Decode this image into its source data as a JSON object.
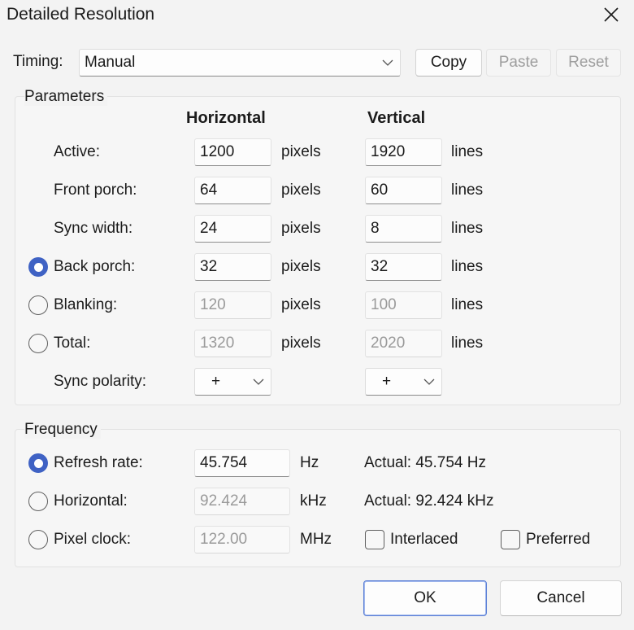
{
  "window": {
    "title": "Detailed Resolution"
  },
  "timing": {
    "label": "Timing:",
    "value": "Manual"
  },
  "actions": {
    "copy": "Copy",
    "paste": "Paste",
    "reset": "Reset"
  },
  "parameters": {
    "group_label": "Parameters",
    "col_horizontal": "Horizontal",
    "col_vertical": "Vertical",
    "h_unit": "pixels",
    "v_unit": "lines",
    "rows": [
      {
        "label": "Active:",
        "h": "1200",
        "v": "1920"
      },
      {
        "label": "Front porch:",
        "h": "64",
        "v": "60"
      },
      {
        "label": "Sync width:",
        "h": "24",
        "v": "8"
      },
      {
        "label": "Back porch:",
        "h": "32",
        "v": "32",
        "selected": true
      },
      {
        "label": "Blanking:",
        "h": "120",
        "v": "100"
      },
      {
        "label": "Total:",
        "h": "1320",
        "v": "2020"
      }
    ],
    "sync_polarity": {
      "label": "Sync polarity:",
      "h": "+",
      "v": "+"
    }
  },
  "frequency": {
    "group_label": "Frequency",
    "refresh": {
      "label": "Refresh rate:",
      "value": "45.754",
      "unit": "Hz",
      "actual": "Actual: 45.754 Hz",
      "selected": true
    },
    "horizontal": {
      "label": "Horizontal:",
      "value": "92.424",
      "unit": "kHz",
      "actual": "Actual: 92.424 kHz"
    },
    "pixel_clock": {
      "label": "Pixel clock:",
      "value": "122.00",
      "unit": "MHz"
    },
    "interlaced": "Interlaced",
    "preferred": "Preferred"
  },
  "footer": {
    "ok": "OK",
    "cancel": "Cancel"
  },
  "colors": {
    "accent": "#3f62c4",
    "background": "#f3f3f3"
  }
}
